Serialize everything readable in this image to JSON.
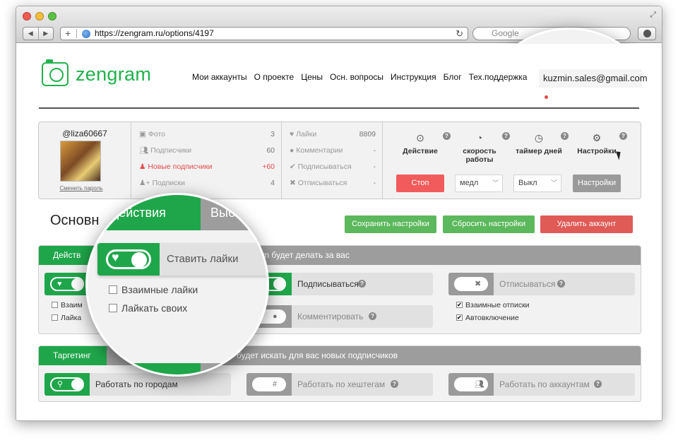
{
  "browser": {
    "url": "https://zengram.ru/options/4197",
    "search_placeholder": "Google"
  },
  "header": {
    "logo_text": "zengram",
    "nav": [
      "Мои аккаунты",
      "О проекте",
      "Цены",
      "Осн. вопросы",
      "Инструкция",
      "Блог",
      "Тех.поддержка"
    ],
    "email": "kuzmin.sales@gmail.com"
  },
  "account": {
    "username": "@liza60667",
    "change_password": "Сменить пароль",
    "stats_left": [
      {
        "label": "Фото",
        "value": "3",
        "icon": "photo-icon"
      },
      {
        "label": "Подписчики",
        "value": "60",
        "icon": "users-icon"
      },
      {
        "label": "Новые подписчики",
        "value": "+60",
        "icon": "user-new-icon"
      },
      {
        "label": "Подписки",
        "value": "4",
        "icon": "user-plus-icon"
      }
    ],
    "stats_right": [
      {
        "label": "Лайки",
        "value": "8809",
        "icon": "heart-icon"
      },
      {
        "label": "Комментарии",
        "value": "-",
        "icon": "comment-icon"
      },
      {
        "label": "Подписываться",
        "value": "-",
        "icon": "check-icon"
      },
      {
        "label": "Отписываться",
        "value": "-",
        "icon": "cross-icon"
      }
    ],
    "controls": {
      "action": "Действие",
      "speed": "скорость работы",
      "timer": "таймер дней",
      "settings": "Настройки",
      "stop_button": "Стоп",
      "speed_value": "медл",
      "timer_value": "Выкл",
      "settings_button": "Настройки"
    }
  },
  "main": {
    "heading": "Основн",
    "save_button": "Сохранить настройки",
    "reset_button": "Сбросить настройки",
    "delete_button": "Удалить аккаунт"
  },
  "actions_band": {
    "tab": "Действ",
    "desc": "m будет делать за вас",
    "cards": {
      "like_checks": [
        "Взаим",
        "Лайка"
      ],
      "follow": "Подписываться",
      "comment": "Комментировать",
      "unfollow": "Отписываться",
      "unfollow_checks": [
        "Взаимные отписки",
        "Автовключение"
      ]
    }
  },
  "targeting_band": {
    "tab": "Таргетинг",
    "desc": "будет искать для вас новых подписчиков",
    "cards": {
      "cities": "Работать по городам",
      "hashtags": "Работать по хештегам",
      "accounts": "Работать по аккаунтам"
    }
  },
  "magnifier": {
    "tab_active": "Действия",
    "tab_inactive": "Выбери",
    "toggle_label": "Ставить лайки",
    "checks": [
      "Взаимные лайки",
      "Лайкать своих"
    ],
    "bottom_tab": "тинг"
  },
  "colors": {
    "green": "#1fa64a",
    "logo_green": "#21b24b",
    "red": "#f25b5b",
    "gray_bar": "#9d9d9d"
  }
}
